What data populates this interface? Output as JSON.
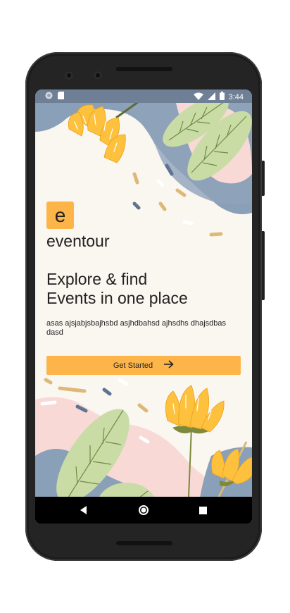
{
  "status_bar": {
    "time": "3:44",
    "icons": [
      "sync-icon",
      "sd-card-icon",
      "wifi-icon",
      "signal-icon",
      "battery-icon"
    ]
  },
  "app": {
    "logo_letter": "e",
    "brand_name": "eventour",
    "headline_line1": "Explore & find",
    "headline_line2": "Events in one place",
    "description": "asas ajsjabjsbajhsbd asjhdbahsd ajhsdhs dhajsdbas dasd",
    "cta_label": "Get Started",
    "cta_icon": "arrow-right-icon"
  },
  "nav_bar": {
    "buttons": [
      "back-icon",
      "home-icon",
      "recents-icon"
    ]
  },
  "colors": {
    "accent": "#fdb54a",
    "background": "#faf6f0",
    "decor_blue": "#8aa0b8",
    "decor_green": "#c9dca5",
    "decor_pink": "#f8d9d6",
    "text": "#222222"
  }
}
